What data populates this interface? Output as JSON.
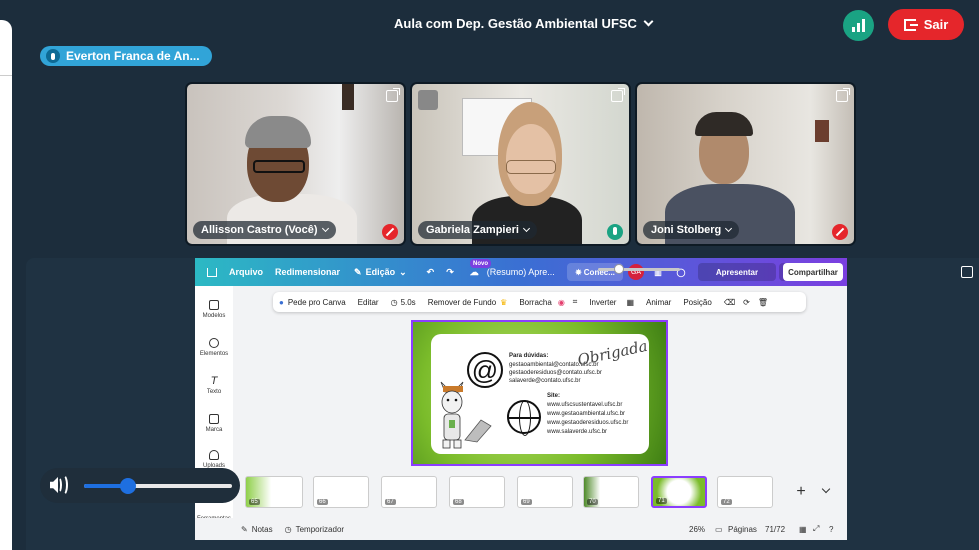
{
  "meeting": {
    "title": "Aula com Dep. Gestão Ambiental UFSC",
    "leave_label": "Sair"
  },
  "presenter": {
    "name": "Everton Franca de An..."
  },
  "participants": [
    {
      "name": "Allisson Castro (Você)",
      "mic": "off"
    },
    {
      "name": "Gabriela Zampieri",
      "mic": "on"
    },
    {
      "name": "Joni Stolberg",
      "mic": "off"
    }
  ],
  "canva": {
    "menu": [
      "Arquivo",
      "Redimensionar",
      "Edição"
    ],
    "new_badge": "Novo",
    "doc_title": "(Resumo) Apre...",
    "connect_label": "Conec...",
    "user_initials": "GA",
    "present_label": "Apresentar",
    "share_label": "Compartilhar",
    "sidebar": [
      "Modelos",
      "Elementos",
      "Texto",
      "Marca",
      "Uploads",
      "Ferramentas"
    ],
    "toolbar": [
      "Pede pro Canva",
      "Editar",
      "5.0s",
      "Remover de Fundo",
      "Borracha",
      "Inverter",
      "Animar",
      "Posição"
    ],
    "slide": {
      "heading": "Para dúvidas:",
      "emails": [
        "gestaoambiental@contato.ufsc.br",
        "gestaoderesiduos@contato.ufsc.br",
        "salaverde@contato.ufsc.br"
      ],
      "site_heading": "Site:",
      "sites": [
        "www.ufscsustentavel.ufsc.br",
        "www.gestaoambiental.ufsc.br",
        "www.gestaoderesiduos.ufsc.br",
        "www.salaverde.ufsc.br"
      ],
      "signature": "Obrigada"
    },
    "thumbnails": [
      "65",
      "66",
      "67",
      "68",
      "69",
      "70",
      "71",
      "72"
    ],
    "selected_thumbnail": "71",
    "status": {
      "notes": "Notas",
      "timer": "Temporizador",
      "zoom": "26%",
      "pages_label": "Páginas",
      "page_count": "71/72"
    },
    "zoom_value": 0.26
  },
  "volume": {
    "level": 0.3
  }
}
